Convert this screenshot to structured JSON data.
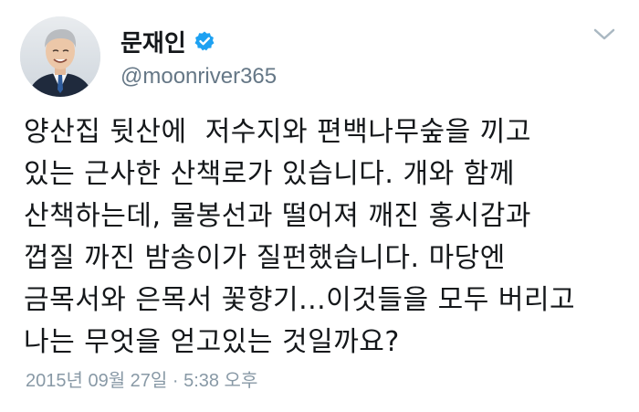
{
  "user": {
    "display_name": "문재인",
    "handle": "@moonriver365",
    "verified": true,
    "avatar_icon": "profile-photo"
  },
  "menu": {
    "icon": "chevron-down-icon"
  },
  "tweet": {
    "lines": [
      "양산집 뒷산에  저수지와 편백나무숲을 끼고",
      "있는 근사한 산책로가 있습니다. 개와 함께",
      "산책하는데, 물봉선과 떨어져 깨진 홍시감과",
      "껍질 까진 밤송이가 질펀했습니다. 마당엔",
      "금목서와 은목서 꽃향기...이것들을 모두 버리고",
      "나는 무엇을 얻고있는 것일까요?"
    ],
    "timestamp": "2015년 09월 27일 · 5:38 오후"
  },
  "colors": {
    "verified_badge": "#1da1f2",
    "handle": "#657786",
    "timestamp": "#8899a6",
    "text": "#14171a"
  }
}
